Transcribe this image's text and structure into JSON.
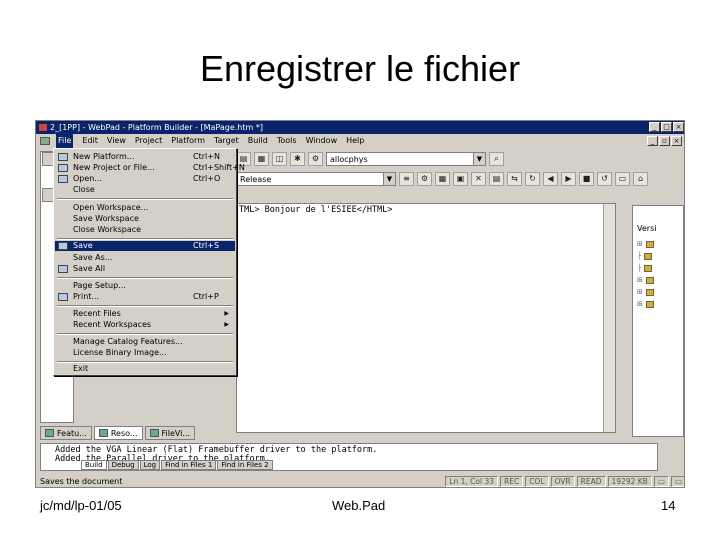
{
  "slide": {
    "title": "Enregistrer le fichier",
    "footer_left": "jc/md/lp-01/05",
    "footer_center": "Web.Pad",
    "footer_right": "14"
  },
  "window": {
    "title": "2_[1PP] - WebPad - Platform Builder - [MaPage.htm *]",
    "menus": [
      "File",
      "Edit",
      "View",
      "Project",
      "Platform",
      "Target",
      "Build",
      "Tools",
      "Window",
      "Help"
    ]
  },
  "toolbar": {
    "search_value": "allocphys",
    "config_value": "Release"
  },
  "file_menu": {
    "items": [
      {
        "label": "New Platform...",
        "shortcut": "Ctrl+N"
      },
      {
        "label": "New Project or File...",
        "shortcut": "Ctrl+Shift+N"
      },
      {
        "label": "Open...",
        "shortcut": "Ctrl+O"
      },
      {
        "label": "Close",
        "shortcut": ""
      },
      {
        "label": "Open Workspace...",
        "shortcut": ""
      },
      {
        "label": "Save Workspace",
        "shortcut": ""
      },
      {
        "label": "Close Workspace",
        "shortcut": ""
      },
      {
        "label": "Save",
        "shortcut": "Ctrl+S"
      },
      {
        "label": "Save As...",
        "shortcut": ""
      },
      {
        "label": "Save All",
        "shortcut": ""
      },
      {
        "label": "Page Setup...",
        "shortcut": ""
      },
      {
        "label": "Print...",
        "shortcut": "Ctrl+P"
      },
      {
        "label": "Recent Files",
        "shortcut": ""
      },
      {
        "label": "Recent Workspaces",
        "shortcut": ""
      },
      {
        "label": "Manage Catalog Features...",
        "shortcut": ""
      },
      {
        "label": "License Binary Image...",
        "shortcut": ""
      },
      {
        "label": "Exit",
        "shortcut": ""
      }
    ]
  },
  "editor": {
    "line1": "TML> Bonjour de l'ESIEE</HTML>"
  },
  "right_pane": {
    "title": "Versi"
  },
  "bottom_tabs": [
    "Featu...",
    "Reso...",
    "FileVi..."
  ],
  "output": {
    "line1": "Added the VGA Linear (Flat) Framebuffer driver to the platform.",
    "line2": "Added the Parallel driver to the platform.",
    "tabs": [
      "Build",
      "Debug",
      "Log",
      "Find in Files 1",
      "Find in Files 2"
    ]
  },
  "status": {
    "text": "Saves the document",
    "position": "Ln 1, Col 33",
    "rec": "REC",
    "col": "COL",
    "ovr": "OVR",
    "read": "READ",
    "size": "19292 KB"
  }
}
